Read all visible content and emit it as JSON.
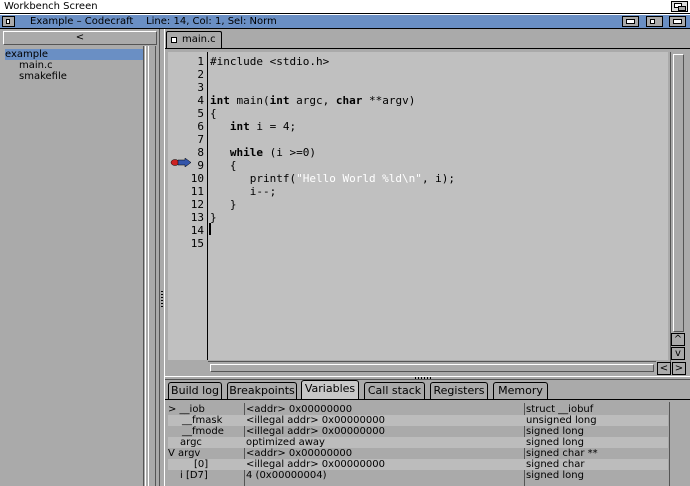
{
  "screen": {
    "title": "Workbench Screen"
  },
  "window": {
    "title": "Example – Codecraft",
    "status": "Line: 14, Col: 1, Sel: Norm"
  },
  "project": {
    "collapse_label": "<",
    "tree": [
      {
        "label": "example",
        "selected": true
      },
      {
        "label": "main.c",
        "selected": false
      },
      {
        "label": "smakefile",
        "selected": false
      }
    ]
  },
  "editor": {
    "tab_label": "main.c",
    "line_numbers": [
      "1",
      "2",
      "3",
      "4",
      "5",
      "6",
      "7",
      "8",
      "9",
      "10",
      "11",
      "12",
      "13",
      "14",
      "15"
    ],
    "breakpoint_line": "9",
    "cursor_line": "14",
    "scroll_arrows": {
      "left": "<",
      "right": ">",
      "up": "^",
      "down": "v"
    }
  },
  "bottom_tabs": [
    {
      "label": "Build log",
      "active": false
    },
    {
      "label": "Breakpoints",
      "active": false
    },
    {
      "label": "Variables",
      "active": true
    },
    {
      "label": "Call stack",
      "active": false
    },
    {
      "label": "Registers",
      "active": false
    },
    {
      "label": "Memory",
      "active": false
    }
  ],
  "variables": [
    {
      "name": "> __iob",
      "value": "<addr> 0x00000000",
      "type": "struct __iobuf"
    },
    {
      "name": "__fmask",
      "value": "<illegal addr> 0x00000000",
      "type": "unsigned long"
    },
    {
      "name": "__fmode",
      "value": "<illegal addr> 0x00000000",
      "type": "signed long"
    },
    {
      "name": "argc",
      "value": "optimized away",
      "type": "signed long"
    },
    {
      "name": "V argv",
      "value": "<addr> 0x00000000",
      "type": "signed char **"
    },
    {
      "name": "[0]",
      "value": "<illegal addr> 0x00000000",
      "type": "signed char"
    },
    {
      "name": "i [D7]",
      "value": "4 (0x00000004)",
      "type": "signed long"
    }
  ],
  "colors": {
    "title_blue": "#6a8fc4",
    "panel_gray": "#aaaaaa",
    "breakpoint_red": "#cc2222",
    "arrow_blue": "#3355aa"
  },
  "icons": [
    "depth-gadget-icon",
    "close-gadget-icon",
    "zoom-gadget-icon",
    "breakpoint-arrow-icon",
    "file-tab-icon"
  ]
}
